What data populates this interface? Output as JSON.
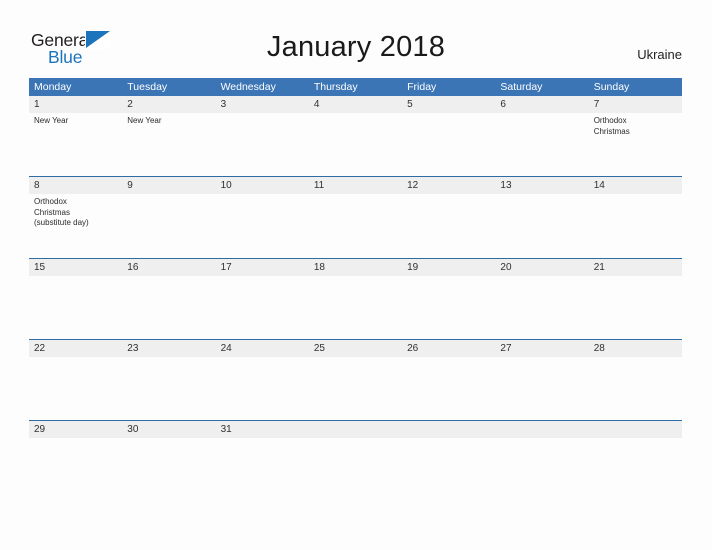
{
  "brand": {
    "name_part1": "General",
    "name_part2": "Blue",
    "flag_icon": "blue-flag-triangle-icon",
    "color_dark": "#231f20",
    "color_blue": "#1c75bc"
  },
  "header": {
    "title": "January 2018",
    "country": "Ukraine"
  },
  "theme": {
    "header_blue": "#3b75b5",
    "rule_blue": "#2e6da4",
    "date_band_gray": "#efefef",
    "page_bg": "#fdfdfd",
    "date_text": "#303030",
    "event_text": "#2b2b2b"
  },
  "calendar": {
    "month": "January",
    "year": "2018",
    "weekday_headers": [
      "Monday",
      "Tuesday",
      "Wednesday",
      "Thursday",
      "Friday",
      "Saturday",
      "Sunday"
    ],
    "weeks": [
      {
        "rule": false,
        "height_class": "wk-h-72",
        "days": [
          {
            "date": "1",
            "events": [
              "New Year"
            ]
          },
          {
            "date": "2",
            "events": [
              "New Year"
            ]
          },
          {
            "date": "3",
            "events": []
          },
          {
            "date": "4",
            "events": []
          },
          {
            "date": "5",
            "events": []
          },
          {
            "date": "6",
            "events": []
          },
          {
            "date": "7",
            "events": [
              "Orthodox",
              "Christmas"
            ]
          }
        ]
      },
      {
        "rule": true,
        "height_class": "wk-h-81",
        "days": [
          {
            "date": "8",
            "events": [
              "Orthodox",
              "Christmas",
              "(substitute day)"
            ]
          },
          {
            "date": "9",
            "events": []
          },
          {
            "date": "10",
            "events": []
          },
          {
            "date": "11",
            "events": []
          },
          {
            "date": "12",
            "events": []
          },
          {
            "date": "13",
            "events": []
          },
          {
            "date": "14",
            "events": []
          }
        ]
      },
      {
        "rule": true,
        "height_class": "wk-h-72",
        "days": [
          {
            "date": "15",
            "events": []
          },
          {
            "date": "16",
            "events": []
          },
          {
            "date": "17",
            "events": []
          },
          {
            "date": "18",
            "events": []
          },
          {
            "date": "19",
            "events": []
          },
          {
            "date": "20",
            "events": []
          },
          {
            "date": "21",
            "events": []
          }
        ]
      },
      {
        "rule": true,
        "height_class": "wk-h-72",
        "days": [
          {
            "date": "22",
            "events": []
          },
          {
            "date": "23",
            "events": []
          },
          {
            "date": "24",
            "events": []
          },
          {
            "date": "25",
            "events": []
          },
          {
            "date": "26",
            "events": []
          },
          {
            "date": "27",
            "events": []
          },
          {
            "date": "28",
            "events": []
          }
        ]
      },
      {
        "rule": true,
        "height_class": "wk-h-last",
        "days": [
          {
            "date": "29",
            "events": []
          },
          {
            "date": "30",
            "events": []
          },
          {
            "date": "31",
            "events": []
          },
          {
            "date": "",
            "events": []
          },
          {
            "date": "",
            "events": []
          },
          {
            "date": "",
            "events": []
          },
          {
            "date": "",
            "events": []
          }
        ]
      }
    ]
  }
}
